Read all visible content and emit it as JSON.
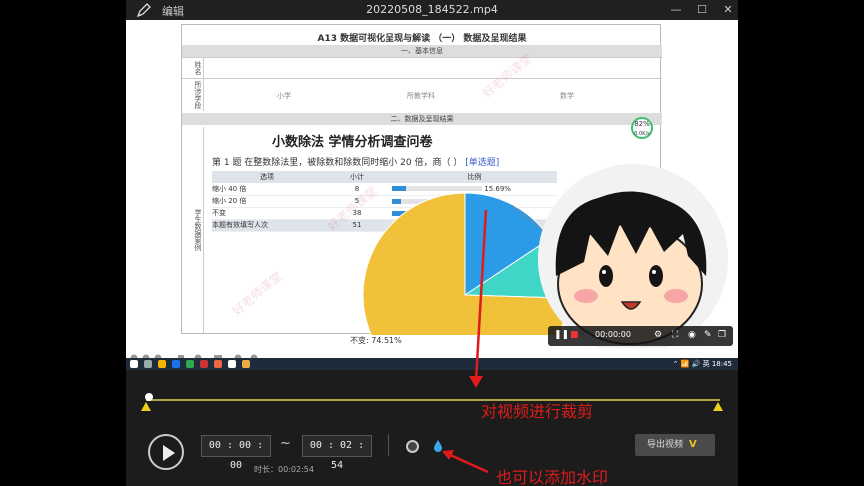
{
  "app": {
    "editor_label": "编辑",
    "file_title": "20220508_184522.mp4",
    "window_controls": {
      "minimize": "—",
      "maximize": "☐",
      "close": "✕"
    }
  },
  "document": {
    "title": "A13 数据可视化呈现与解读 （一） 数据及呈现结果",
    "section1": "一、基本信息",
    "section2": "二、数据及呈现结果",
    "row_labels": {
      "name": "姓名",
      "school": "所涉学段",
      "cases": "学生数据案例"
    },
    "cells": {
      "school": "小学",
      "subject": "所教学科",
      "math": "数学"
    },
    "survey_title": "小数除法  学情分析调查问卷",
    "question": "第 1 题    在整数除法里，被除数和除数同时缩小 20 倍，商（        ）",
    "question_tag": "[单选题]",
    "table": {
      "headers": [
        "选项",
        "小计",
        "比例"
      ],
      "rows": [
        {
          "option": "缩小 40 倍",
          "count": "8",
          "percent": "15.69%",
          "fraction": 0.1569
        },
        {
          "option": "缩小 20 倍",
          "count": "5",
          "percent": "9.8%",
          "fraction": 0.098
        },
        {
          "option": "不变",
          "count": "38",
          "percent": "74.51%",
          "fraction": 0.7451
        }
      ],
      "footer": {
        "label": "本题有效填写人次",
        "count": "51"
      }
    },
    "pie_label": "不变: 74.51%",
    "other_label": "缩",
    "badge": {
      "value": "82",
      "unit": "%",
      "sub": "0.0K/s"
    },
    "watermark": "好老师课堂"
  },
  "webcam": {
    "time": "00:00:00"
  },
  "taskbar": {
    "tray": "⌃ 📶 🔊 英  18:45"
  },
  "timeline": {
    "start_time": "00 : 00 : 00",
    "end_time": "00 : 02 : 54",
    "tilde": "~",
    "duration": "时长：00:02:54",
    "export_label": "导出视频",
    "export_badge": "V"
  },
  "annotations": {
    "crop": "对视频进行裁剪",
    "watermark": "也可以添加水印"
  },
  "colors": {
    "accent": "#e8d21d",
    "annotation": "#e01b1b",
    "bar": "#2f8fd9",
    "pie_yellow": "#f2c13a",
    "pie_blue": "#2b9be8",
    "pie_teal": "#3fd6c8"
  },
  "chart_data": {
    "type": "pie",
    "categories": [
      "缩小 40 倍",
      "缩小 20 倍",
      "不变"
    ],
    "values": [
      15.69,
      9.8,
      74.51
    ]
  }
}
